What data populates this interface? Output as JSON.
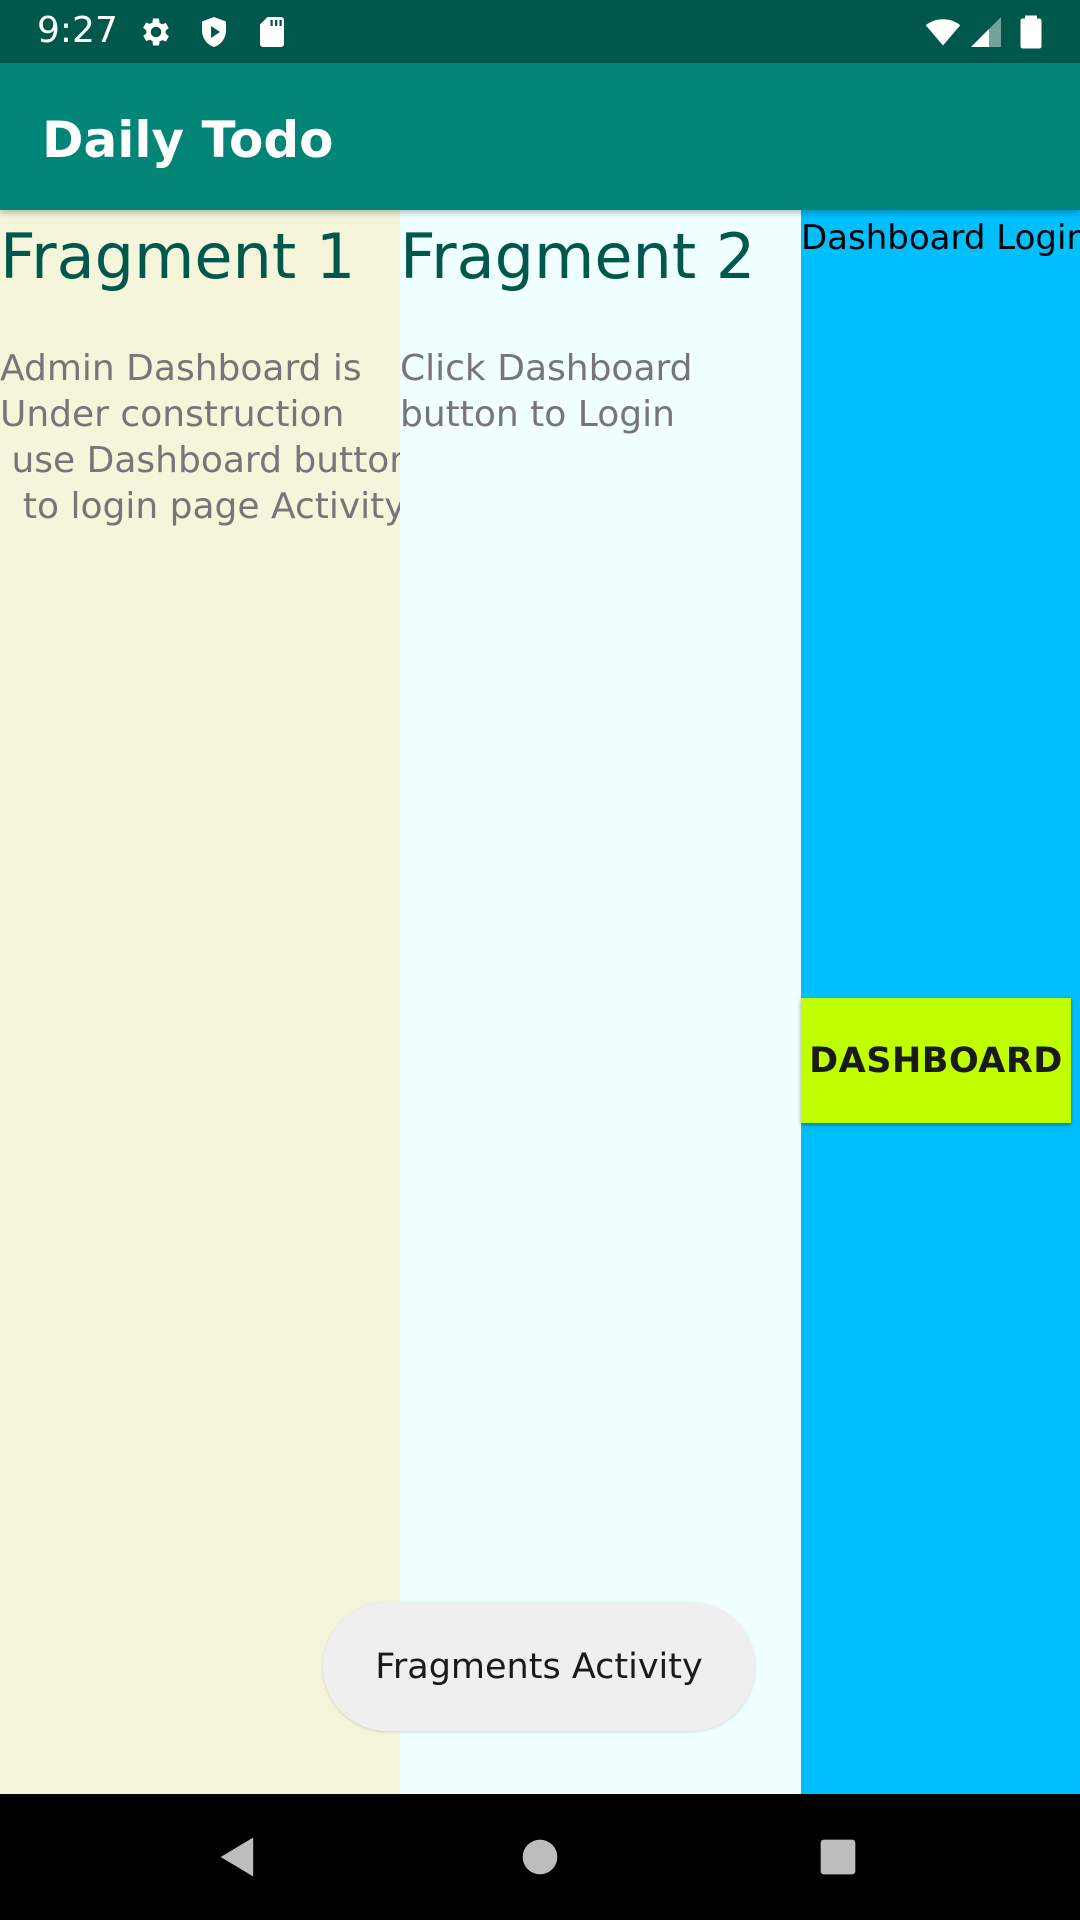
{
  "status_bar": {
    "time": "9:27",
    "icons": [
      "gear-icon",
      "shield-icon",
      "sd-card-icon",
      "wifi-icon",
      "cell-signal-icon",
      "battery-icon"
    ],
    "background": "#00574B"
  },
  "app_bar": {
    "title": "Daily Todo",
    "background": "#008577"
  },
  "fragments": [
    {
      "title": "Fragment 1",
      "body": "Admin Dashboard is\nUnder construction\n use Dashboard button\n  to login page Activity",
      "background": "#F5F5DC"
    },
    {
      "title": "Fragment 2",
      "body": "Click Dashboard\nbutton to Login",
      "background": "#F0FFFF"
    },
    {
      "title": "Dashboard Login",
      "button_label": "DASHBOARD",
      "background": "#00BFFF",
      "button_color": "#BFFF00"
    }
  ],
  "toast": {
    "text": "Fragments Activity"
  },
  "nav_bar": {
    "icons": [
      "back-icon",
      "home-icon",
      "recents-icon"
    ]
  }
}
